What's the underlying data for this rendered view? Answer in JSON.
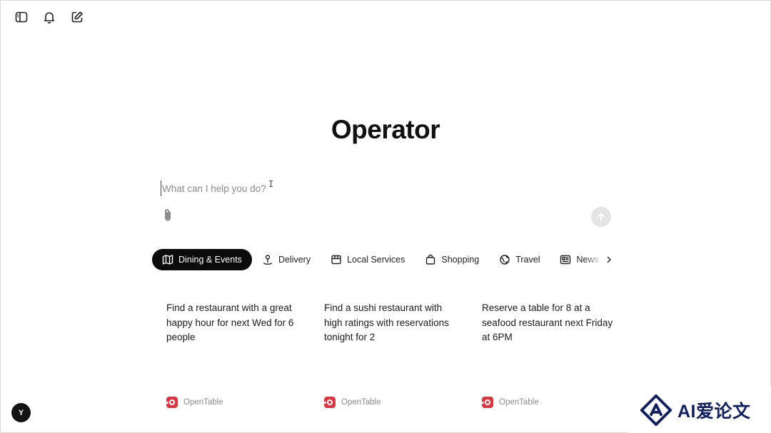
{
  "topbar": {
    "icons": [
      "sidebar-toggle-icon",
      "bell-icon",
      "new-chat-icon"
    ]
  },
  "main": {
    "title": "Operator",
    "prompt": {
      "placeholder": "What can I help you do?",
      "value": ""
    }
  },
  "tabs": [
    {
      "label": "Dining & Events",
      "icon": "map-icon",
      "active": true
    },
    {
      "label": "Delivery",
      "icon": "location-pin-icon",
      "active": false
    },
    {
      "label": "Local Services",
      "icon": "storefront-icon",
      "active": false
    },
    {
      "label": "Shopping",
      "icon": "shopping-bag-icon",
      "active": false
    },
    {
      "label": "Travel",
      "icon": "globe-icon",
      "active": false
    },
    {
      "label": "News",
      "icon": "newspaper-icon",
      "active": false
    }
  ],
  "cards": [
    {
      "text": "Find a restaurant with a great happy hour for next Wed for 6 people",
      "source": "OpenTable"
    },
    {
      "text": "Find a sushi restaurant with high ratings with reservations tonight for 2",
      "source": "OpenTable"
    },
    {
      "text": "Reserve a table for 8 at a seafood restaurant next Friday at 6PM",
      "source": "OpenTable"
    }
  ],
  "user": {
    "initial": "Y"
  },
  "watermark": {
    "text": "AI爱论文"
  },
  "colors": {
    "active_tab_bg": "#0b0b0b",
    "opentable_red": "#da3743",
    "send_button_bg": "#e4e4e4"
  }
}
